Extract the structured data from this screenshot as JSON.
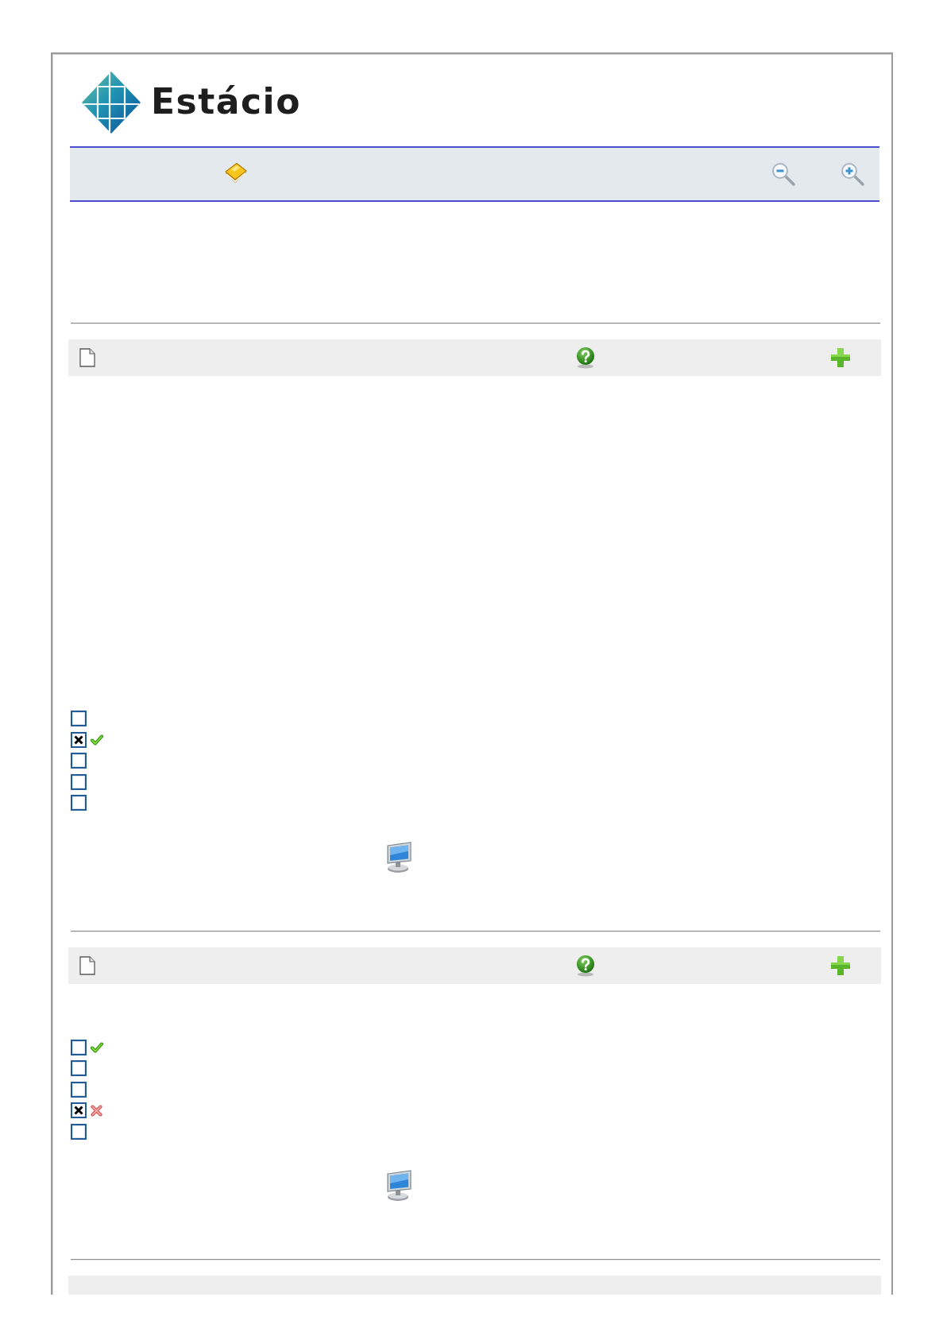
{
  "logo": {
    "text": "Estácio"
  },
  "questions": [
    {
      "cut": false,
      "options": [
        {
          "checked": false,
          "kind": "plain"
        },
        {
          "checked": true,
          "kind": "correct"
        },
        {
          "checked": false,
          "kind": "plain"
        },
        {
          "checked": false,
          "kind": "plain"
        },
        {
          "checked": false,
          "kind": "plain"
        }
      ]
    },
    {
      "cut": false,
      "options": [
        {
          "checked": false,
          "kind": "correct"
        },
        {
          "checked": false,
          "kind": "plain"
        },
        {
          "checked": false,
          "kind": "plain"
        },
        {
          "checked": true,
          "kind": "wrong"
        },
        {
          "checked": false,
          "kind": "plain"
        }
      ]
    },
    {
      "cut": true
    }
  ]
}
